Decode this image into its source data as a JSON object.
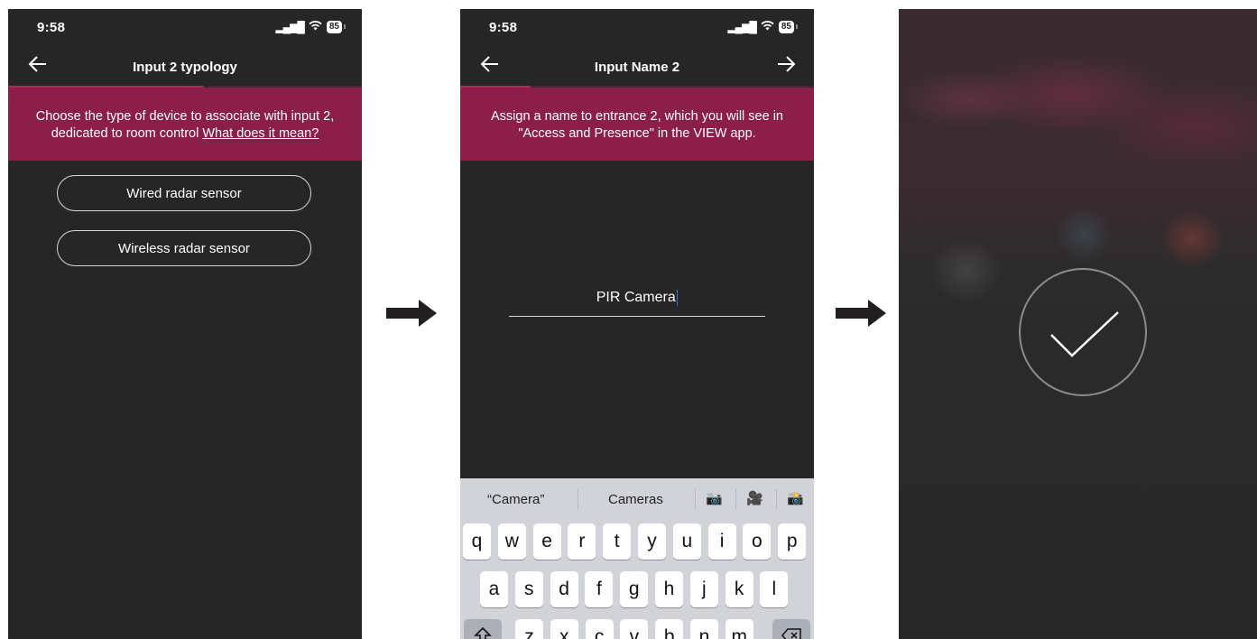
{
  "screen1": {
    "status_time": "9:58",
    "battery": "85",
    "nav_back_icon": "arrow-left-icon",
    "title": "Input 2 typology",
    "progress_percent": 55,
    "banner_text": "Choose the type of device to associate with input 2, dedicated to room control",
    "banner_link": "What does it mean?",
    "options": [
      "Wired radar sensor",
      "Wireless radar sensor"
    ]
  },
  "screen2": {
    "status_time": "9:58",
    "battery": "85",
    "nav_back_icon": "arrow-left-icon",
    "nav_forward_icon": "arrow-right-icon",
    "title": "Input Name 2",
    "progress_percent": 20,
    "banner_text": "Assign a name to entrance 2, which you will see in \"Access and Presence\" in the VIEW app.",
    "input_value": "PIR Camera",
    "keyboard": {
      "suggestions": [
        "“Camera”",
        "Cameras"
      ],
      "emoji_suggestions": [
        "📷",
        "🎥",
        "📸"
      ],
      "row1": [
        "q",
        "w",
        "e",
        "r",
        "t",
        "y",
        "u",
        "i",
        "o",
        "p"
      ],
      "row2": [
        "a",
        "s",
        "d",
        "f",
        "g",
        "h",
        "j",
        "k",
        "l"
      ],
      "row3": [
        "z",
        "x",
        "c",
        "v",
        "b",
        "n",
        "m"
      ],
      "shift_icon": "shift-icon",
      "delete_icon": "backspace-icon"
    }
  },
  "screen3": {
    "check_icon": "checkmark-icon"
  },
  "colors": {
    "banner": "#8b1f47",
    "background": "#262626",
    "accent": "#b5294f"
  }
}
